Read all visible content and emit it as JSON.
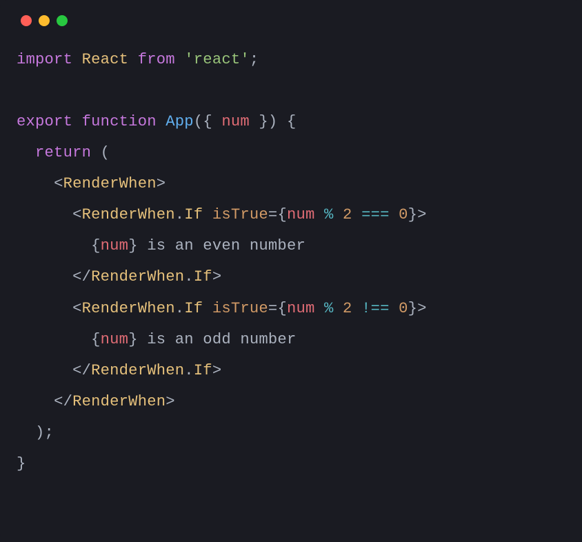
{
  "traffic_lights": {
    "red": "#ff5f57",
    "yellow": "#febc2e",
    "green": "#28c840"
  },
  "code": {
    "l1": {
      "import": "import",
      "react_ident": "React",
      "from": "from",
      "react_str": "'react'",
      "semi": ";"
    },
    "l2": "",
    "l3": {
      "export": "export",
      "function": "function",
      "fn": "App",
      "lparen": "(",
      "lbrace": "{",
      "param": "num",
      "rbrace": "}",
      "rparen": ")",
      "space_lbrace": " {"
    },
    "l4": {
      "return": "return",
      "lparen": " ("
    },
    "l5": {
      "open": "<",
      "tag": "RenderWhen",
      "close": ">"
    },
    "l6": {
      "open": "<",
      "tag": "RenderWhen",
      "dot": ".",
      "member": "If",
      "attr": "isTrue",
      "eq": "=",
      "lbrace": "{",
      "id": "num",
      "op1": " % ",
      "n1": "2",
      "op2": " === ",
      "n2": "0",
      "rbrace": "}",
      "close": ">"
    },
    "l7": {
      "lbrace": "{",
      "id": "num",
      "rbrace": "}",
      "text": " is an even number"
    },
    "l8": {
      "open": "</",
      "tag": "RenderWhen",
      "dot": ".",
      "member": "If",
      "close": ">"
    },
    "l9": {
      "open": "<",
      "tag": "RenderWhen",
      "dot": ".",
      "member": "If",
      "attr": "isTrue",
      "eq": "=",
      "lbrace": "{",
      "id": "num",
      "op1": " % ",
      "n1": "2",
      "op2": " !== ",
      "n2": "0",
      "rbrace": "}",
      "close": ">"
    },
    "l10": {
      "lbrace": "{",
      "id": "num",
      "rbrace": "}",
      "text": " is an odd number"
    },
    "l11": {
      "open": "</",
      "tag": "RenderWhen",
      "dot": ".",
      "member": "If",
      "close": ">"
    },
    "l12": {
      "open": "</",
      "tag": "RenderWhen",
      "close": ">"
    },
    "l13": {
      "rparen_semi": ");"
    },
    "l14": {
      "rbrace": "}"
    }
  }
}
